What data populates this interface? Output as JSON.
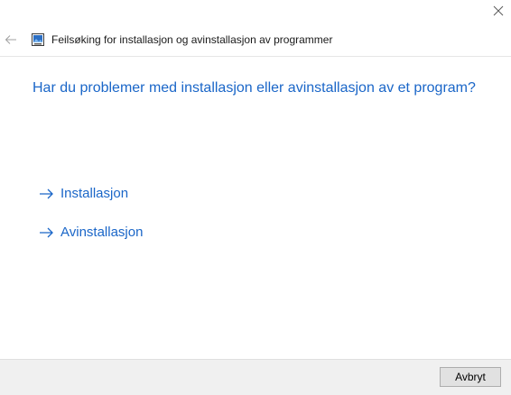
{
  "window": {
    "title": "Feilsøking for installasjon og avinstallasjon av programmer"
  },
  "main": {
    "heading": "Har du problemer med installasjon eller avinstallasjon av et program?",
    "options": [
      {
        "label": "Installasjon",
        "icon": "arrow-right-icon"
      },
      {
        "label": "Avinstallasjon",
        "icon": "arrow-right-icon"
      }
    ]
  },
  "footer": {
    "cancel_label": "Avbryt"
  },
  "icons": {
    "close": "close-icon",
    "back": "back-arrow-icon",
    "app": "troubleshooter-app-icon"
  },
  "colors": {
    "accent": "#1a66c8",
    "footer_bg": "#f0f0f0",
    "button_bg": "#e1e1e1"
  }
}
